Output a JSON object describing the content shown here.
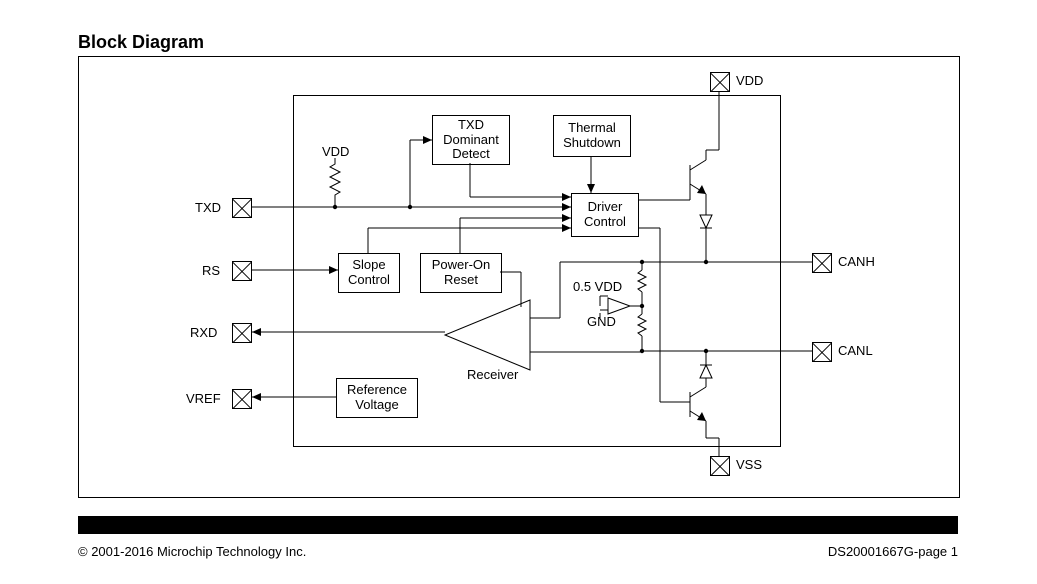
{
  "title": "Block Diagram",
  "pins": {
    "vdd_top": "VDD",
    "txd": "TXD",
    "rs": "RS",
    "rxd": "RXD",
    "vref": "VREF",
    "canh": "CANH",
    "canl": "CANL",
    "vss": "VSS"
  },
  "blocks": {
    "txd_dominant_detect": "TXD\nDominant\nDetect",
    "thermal_shutdown": "Thermal\nShutdown",
    "driver_control": "Driver\nControl",
    "slope_control": "Slope\nControl",
    "power_on_reset": "Power-On\nReset",
    "reference_voltage": "Reference\nVoltage"
  },
  "labels": {
    "vdd_pullup": "VDD",
    "receiver": "Receiver",
    "half_vdd": "0.5 VDD",
    "gnd": "GND"
  },
  "footer": {
    "left": "© 2001-2016 Microchip Technology Inc.",
    "right": "DS20001667G-page 1"
  }
}
